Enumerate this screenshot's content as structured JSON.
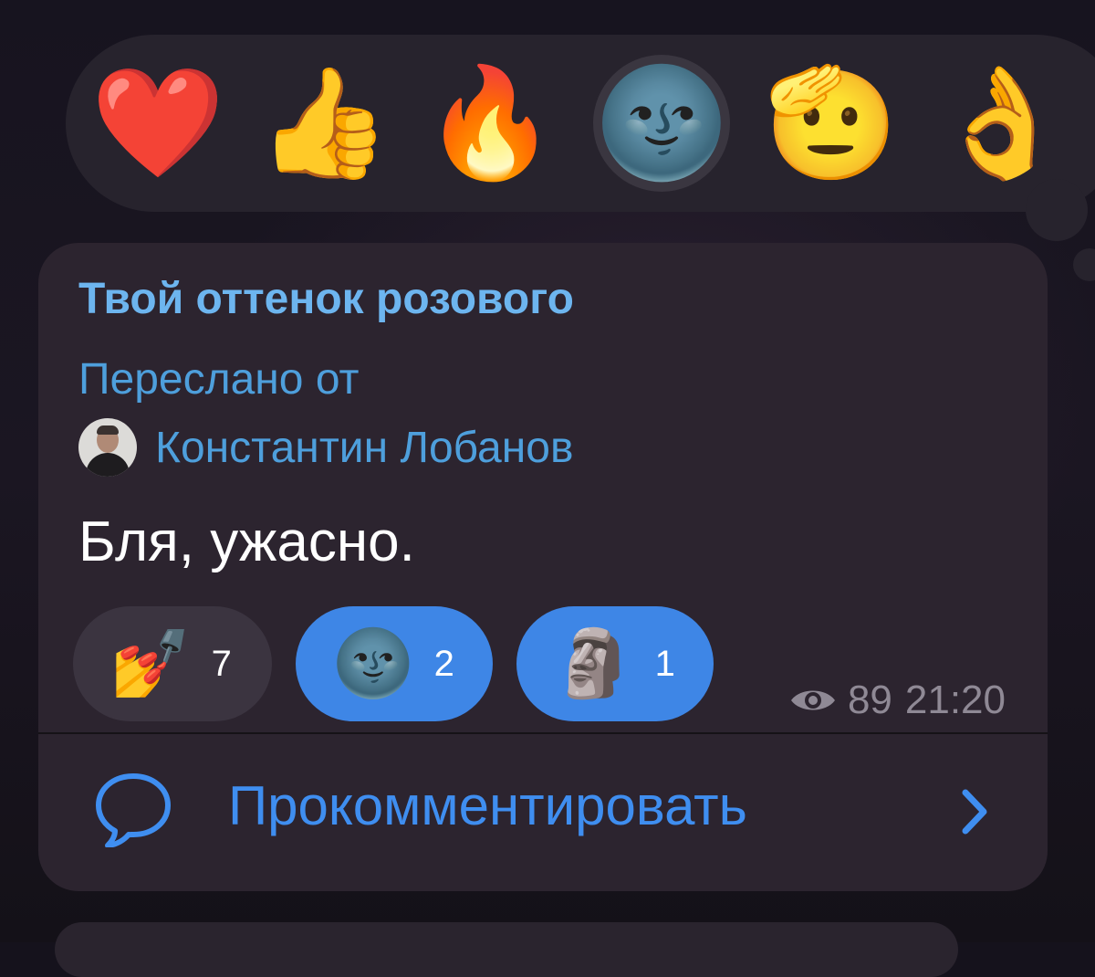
{
  "picker": {
    "emojis": [
      {
        "name": "heart",
        "glyph": "❤️"
      },
      {
        "name": "thumbs-up",
        "glyph": "👍"
      },
      {
        "name": "fire",
        "glyph": "🔥"
      },
      {
        "name": "new-moon-face",
        "glyph": "🌚"
      },
      {
        "name": "saluting-face",
        "glyph": "🫡"
      },
      {
        "name": "ok-hand",
        "glyph": "👌"
      }
    ],
    "selected": "new-moon-face"
  },
  "message": {
    "channel_name": "Твой оттенок розового",
    "forwarded_label": "Переслано от",
    "forwarded_author": "Константин Лобанов",
    "text": "Бля, ужасно.",
    "views": "89",
    "time": "21:20"
  },
  "reactions": [
    {
      "name": "nail-polish",
      "glyph": "💅",
      "count": "7",
      "mine": false
    },
    {
      "name": "new-moon-face",
      "glyph": "🌚",
      "count": "2",
      "mine": true
    },
    {
      "name": "moai",
      "glyph": "🗿",
      "count": "1",
      "mine": true
    }
  ],
  "comment": {
    "label": "Прокомментировать"
  },
  "colors": {
    "accent": "#3f8ef0",
    "channel_name": "#6db5ef",
    "bubble": "#2c242f",
    "reaction_mine": "#3e86e6"
  }
}
